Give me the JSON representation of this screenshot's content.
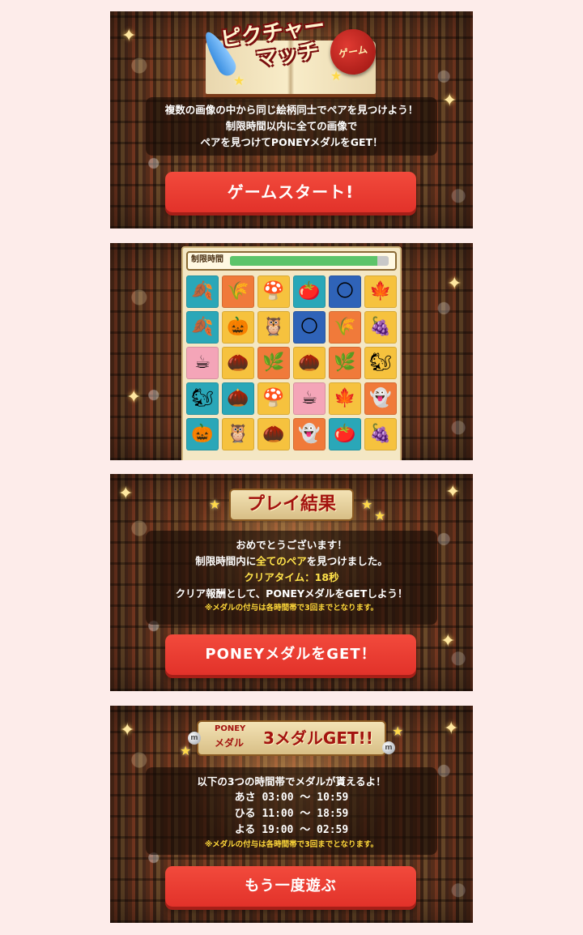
{
  "start_panel": {
    "title_line1": "ピクチャー",
    "title_line2": "マッチ",
    "seal": "ゲーム",
    "desc": [
      "複数の画像の中から同じ絵柄同士でペアを見つけよう！",
      "制限時間以内に全ての画像で",
      "ペアを見つけてPONEYメダルをGET！"
    ],
    "button": "ゲームスタート!"
  },
  "game_panel": {
    "timer_label": "制限時間",
    "timer_remaining": 0.93,
    "tiles": [
      {
        "name": "leaves",
        "icon": "🍂",
        "bg": "#2aa7b8"
      },
      {
        "name": "wheat",
        "icon": "🌾",
        "bg": "#f07a3a"
      },
      {
        "name": "mushroom",
        "icon": "🍄",
        "bg": "#f6c23e"
      },
      {
        "name": "persimmon",
        "icon": "🍅",
        "bg": "#2aa7b8"
      },
      {
        "name": "moon",
        "icon": "🌕",
        "bg": "#2f63b8"
      },
      {
        "name": "maple",
        "icon": "🍁",
        "bg": "#f6c23e"
      },
      {
        "name": "leaves",
        "icon": "🍂",
        "bg": "#2aa7b8"
      },
      {
        "name": "pumpkin",
        "icon": "🎃",
        "bg": "#f6c23e"
      },
      {
        "name": "owl",
        "icon": "🦉",
        "bg": "#f6c23e"
      },
      {
        "name": "moon",
        "icon": "🌕",
        "bg": "#2f63b8"
      },
      {
        "name": "wheat",
        "icon": "🌾",
        "bg": "#f07a3a"
      },
      {
        "name": "grapes",
        "icon": "🍇",
        "bg": "#f6c23e"
      },
      {
        "name": "tea",
        "icon": "☕",
        "bg": "#f4a5b8"
      },
      {
        "name": "acorn",
        "icon": "🌰",
        "bg": "#f6c23e"
      },
      {
        "name": "ginkgo",
        "icon": "🌿",
        "bg": "#f07a3a"
      },
      {
        "name": "chestnut",
        "icon": "🌰",
        "bg": "#f6c23e"
      },
      {
        "name": "ginkgo",
        "icon": "🌿",
        "bg": "#f07a3a"
      },
      {
        "name": "squirrel",
        "icon": "🐿",
        "bg": "#f6c23e"
      },
      {
        "name": "squirrel",
        "icon": "🐿",
        "bg": "#2aa7b8"
      },
      {
        "name": "chestnut",
        "icon": "🌰",
        "bg": "#2aa7b8"
      },
      {
        "name": "mushroom",
        "icon": "🍄",
        "bg": "#f6c23e"
      },
      {
        "name": "tea",
        "icon": "☕",
        "bg": "#f4a5b8"
      },
      {
        "name": "maple",
        "icon": "🍁",
        "bg": "#f6c23e"
      },
      {
        "name": "ghost",
        "icon": "👻",
        "bg": "#f07a3a"
      },
      {
        "name": "pumpkin",
        "icon": "🎃",
        "bg": "#2aa7b8"
      },
      {
        "name": "owl",
        "icon": "🦉",
        "bg": "#f6c23e"
      },
      {
        "name": "acorn",
        "icon": "🌰",
        "bg": "#f6c23e"
      },
      {
        "name": "ghost",
        "icon": "👻",
        "bg": "#f07a3a"
      },
      {
        "name": "persimmon",
        "icon": "🍅",
        "bg": "#2aa7b8"
      },
      {
        "name": "grapes",
        "icon": "🍇",
        "bg": "#f6c23e"
      }
    ]
  },
  "result_panel": {
    "banner": "プレイ結果",
    "line1": "おめでとうございます！",
    "line2_pre": "制限時間内に",
    "line2_highlight": "全てのペア",
    "line2_post": "を見つけました。",
    "clear_time": "クリアタイム：18秒",
    "line4": "クリア報酬として、PONEYメダルをGETしよう！",
    "note": "※メダルの付与は各時間帯で3回までとなります。",
    "button": "PONEYメダルをGET！"
  },
  "medal_panel": {
    "banner_small1": "PONEY",
    "banner_small2": "メダル",
    "banner_big": "3メダルGET!!",
    "intro": "以下の3つの時間帯でメダルが貰えるよ！",
    "slots": [
      "あさ 03:00 ～ 10:59",
      "ひる 11:00 ～ 18:59",
      "よる 19:00 ～ 02:59"
    ],
    "note": "※メダルの付与は各時間帯で3回までとなります。",
    "button": "もう一度遊ぶ"
  },
  "colors": {
    "button_red": "#e8362d",
    "highlight_yellow": "#ffe24a",
    "timer_green": "#5cc46a",
    "page_bg": "#fdecea"
  }
}
